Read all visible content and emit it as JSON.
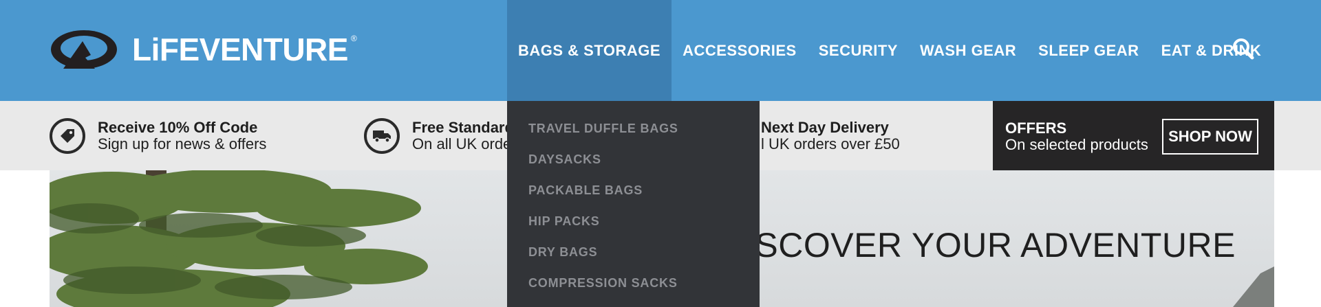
{
  "brand": {
    "name": "LiFEVENTURE",
    "reg": "®"
  },
  "nav": {
    "items": [
      {
        "label": "BAGS & STORAGE",
        "active": true
      },
      {
        "label": "ACCESSORIES"
      },
      {
        "label": "SECURITY"
      },
      {
        "label": "WASH GEAR"
      },
      {
        "label": "SLEEP GEAR"
      },
      {
        "label": "EAT & DRINK"
      }
    ],
    "search_icon": "search-icon"
  },
  "dropdown": {
    "items": [
      "TRAVEL DUFFLE BAGS",
      "DAYSACKS",
      "PACKABLE BAGS",
      "HIP PACKS",
      "DRY BAGS",
      "COMPRESSION SACKS"
    ]
  },
  "benefits": [
    {
      "icon": "tag-icon",
      "title": "Receive 10% Off Code",
      "subtitle": "Sign up for news & offers"
    },
    {
      "icon": "truck-icon",
      "title": "Free Standard",
      "subtitle": "On all UK order"
    },
    {
      "icon": "",
      "title": "Next Day Delivery",
      "subtitle": "l UK orders over £50"
    }
  ],
  "offers": {
    "title": "OFFERS",
    "subtitle": "On selected products",
    "cta": "SHOP NOW"
  },
  "hero": {
    "headline": "DISCOVER YOUR ADVENTURE"
  },
  "colors": {
    "header": "#4b98cf",
    "nav_active": "#3d7fb2",
    "strip": "#e9e9e9",
    "offers": "#262526",
    "dropdown": "#323438",
    "dropdown_text": "#8d8f94"
  }
}
